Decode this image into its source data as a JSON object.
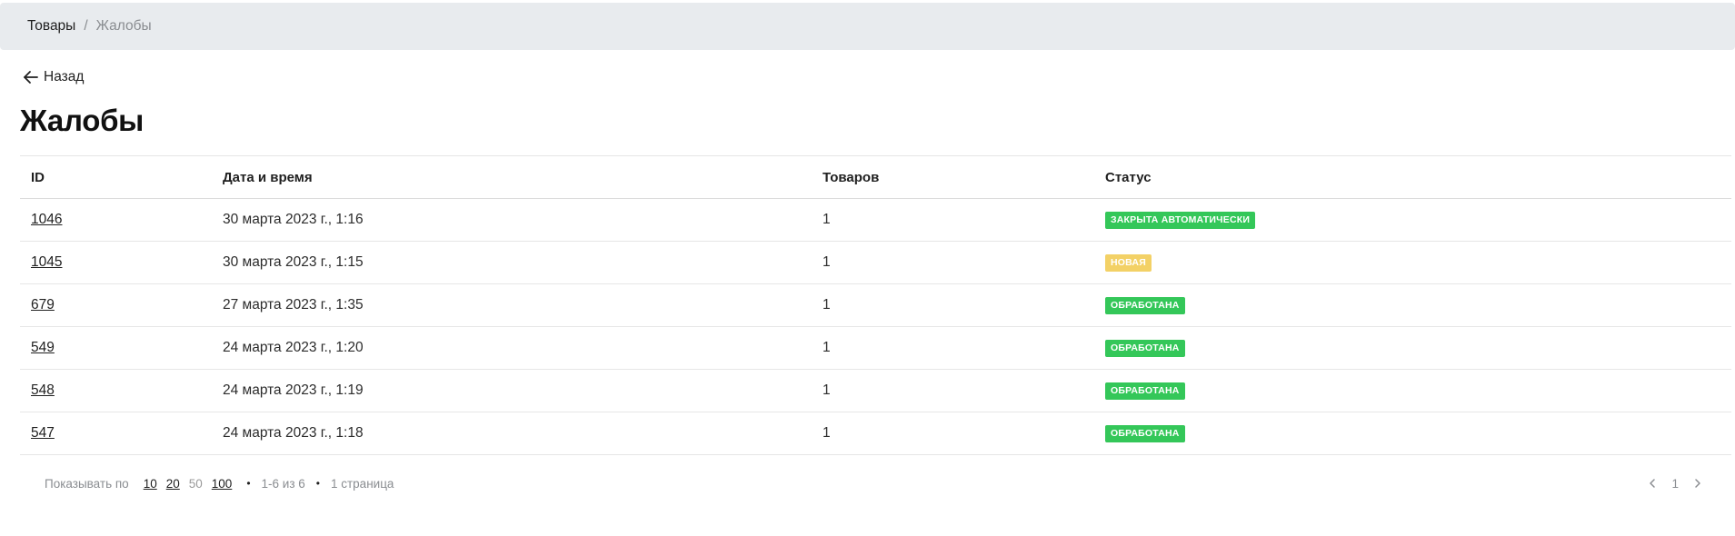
{
  "breadcrumb": {
    "root": "Товары",
    "separator": "/",
    "current": "Жалобы"
  },
  "back": {
    "label": "Назад"
  },
  "page": {
    "title": "Жалобы"
  },
  "table": {
    "columns": [
      "ID",
      "Дата и время",
      "Товаров",
      "Статус"
    ],
    "rows": [
      {
        "id": "1046",
        "datetime": "30 марта 2023 г., 1:16",
        "count": "1",
        "status": "Закрыта автоматически",
        "status_color": "#34c759"
      },
      {
        "id": "1045",
        "datetime": "30 марта 2023 г., 1:15",
        "count": "1",
        "status": "Новая",
        "status_color": "#f3d166"
      },
      {
        "id": "679",
        "datetime": "27 марта 2023 г., 1:35",
        "count": "1",
        "status": "Обработана",
        "status_color": "#34c759"
      },
      {
        "id": "549",
        "datetime": "24 марта 2023 г., 1:20",
        "count": "1",
        "status": "Обработана",
        "status_color": "#34c759"
      },
      {
        "id": "548",
        "datetime": "24 марта 2023 г., 1:19",
        "count": "1",
        "status": "Обработана",
        "status_color": "#34c759"
      },
      {
        "id": "547",
        "datetime": "24 марта 2023 г., 1:18",
        "count": "1",
        "status": "Обработана",
        "status_color": "#34c759"
      }
    ]
  },
  "pagination": {
    "show_label": "Показывать по",
    "page_sizes": [
      "10",
      "20",
      "50",
      "100"
    ],
    "active_size": "50",
    "range": "1-6 из 6",
    "pages_label": "1 страница",
    "current_page": "1",
    "bullet": "•"
  },
  "icons": {
    "back": "arrow-left-icon",
    "prev": "chevron-left-icon",
    "next": "chevron-right-icon"
  },
  "colors": {
    "topbar_bg": "#e8ebee",
    "status_green": "#34c759",
    "status_yellow": "#f3d166"
  }
}
